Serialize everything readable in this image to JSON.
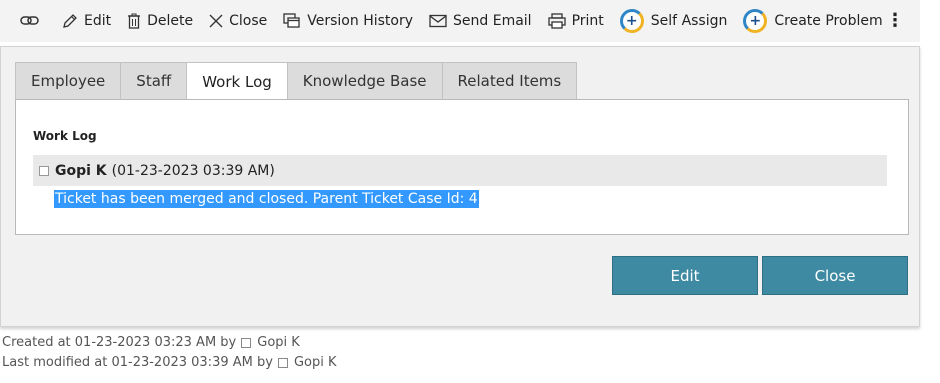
{
  "toolbar": {
    "items": [
      {
        "icon": "link-icon",
        "label": ""
      },
      {
        "icon": "edit-icon",
        "label": "Edit"
      },
      {
        "icon": "trash-icon",
        "label": "Delete"
      },
      {
        "icon": "close-icon",
        "label": "Close"
      },
      {
        "icon": "version-history-icon",
        "label": "Version History"
      },
      {
        "icon": "envelope-icon",
        "label": "Send Email"
      },
      {
        "icon": "printer-icon",
        "label": "Print"
      },
      {
        "icon": "self-assign-icon",
        "label": "Self Assign"
      },
      {
        "icon": "create-problem-icon",
        "label": "Create Problem"
      }
    ],
    "more_glyph": "⋮"
  },
  "tabs": [
    {
      "label": "Employee",
      "active": false
    },
    {
      "label": "Staff",
      "active": false
    },
    {
      "label": "Work Log",
      "active": true
    },
    {
      "label": "Knowledge Base",
      "active": false
    },
    {
      "label": "Related Items",
      "active": false
    }
  ],
  "worklog": {
    "title": "Work Log",
    "entry": {
      "author": "Gopi K",
      "timestamp": "(01-23-2023 03:39 AM)",
      "text": "Ticket has been merged and closed. Parent Ticket Case Id: 4"
    }
  },
  "buttons": {
    "edit": "Edit",
    "close": "Close"
  },
  "footer": {
    "created_prefix": "Created at 01-23-2023 03:23 AM by",
    "created_by": "Gopi K",
    "modified_prefix": "Last modified at 01-23-2023 03:39 AM by",
    "modified_by": "Gopi K"
  },
  "colors": {
    "accent_button": "#3f8aa3",
    "selection": "#3399ff",
    "badge_blue": "#2f86c6",
    "badge_yellow": "#f0b323"
  }
}
